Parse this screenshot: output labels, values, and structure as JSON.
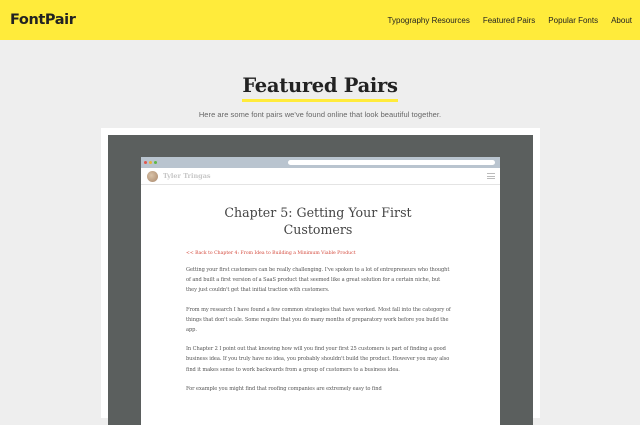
{
  "header": {
    "logo": "FontPair",
    "nav": [
      "Typography Resources",
      "Featured Pairs",
      "Popular Fonts",
      "About"
    ],
    "colors": {
      "accent": "#ffeb3b"
    }
  },
  "hero": {
    "title": "Featured Pairs",
    "subtitle": "Here are some font pairs we've found online that look beautiful together."
  },
  "preview": {
    "site_name": "Tyler Tringas",
    "chapter_title": "Chapter 5: Getting Your First Customers",
    "back_link": "<< Back to Chapter 4: From Idea to Building a Minimum Viable Product",
    "paragraphs": [
      "Getting your first customers can be really challenging. I've spoken to a lot of entrepreneurs who thought of and built a first version of a SaaS product that seemed like a great solution for a certain niche, but they just couldn't get that initial traction with customers.",
      "From my research I have found a few common strategies that have worked. Most fall into the category of things that don't scale. Some require that you do many months of preparatory work before you build the app.",
      "In Chapter 2 I point out that knowing how will you find your first 25 customers is part of finding a good business idea. If you truly have no idea, you probably shouldn't build the product. However you may also find it makes sense to work backwards from a group of customers to a business idea.",
      "For example you might find that roofing companies are extremely easy to find"
    ]
  }
}
